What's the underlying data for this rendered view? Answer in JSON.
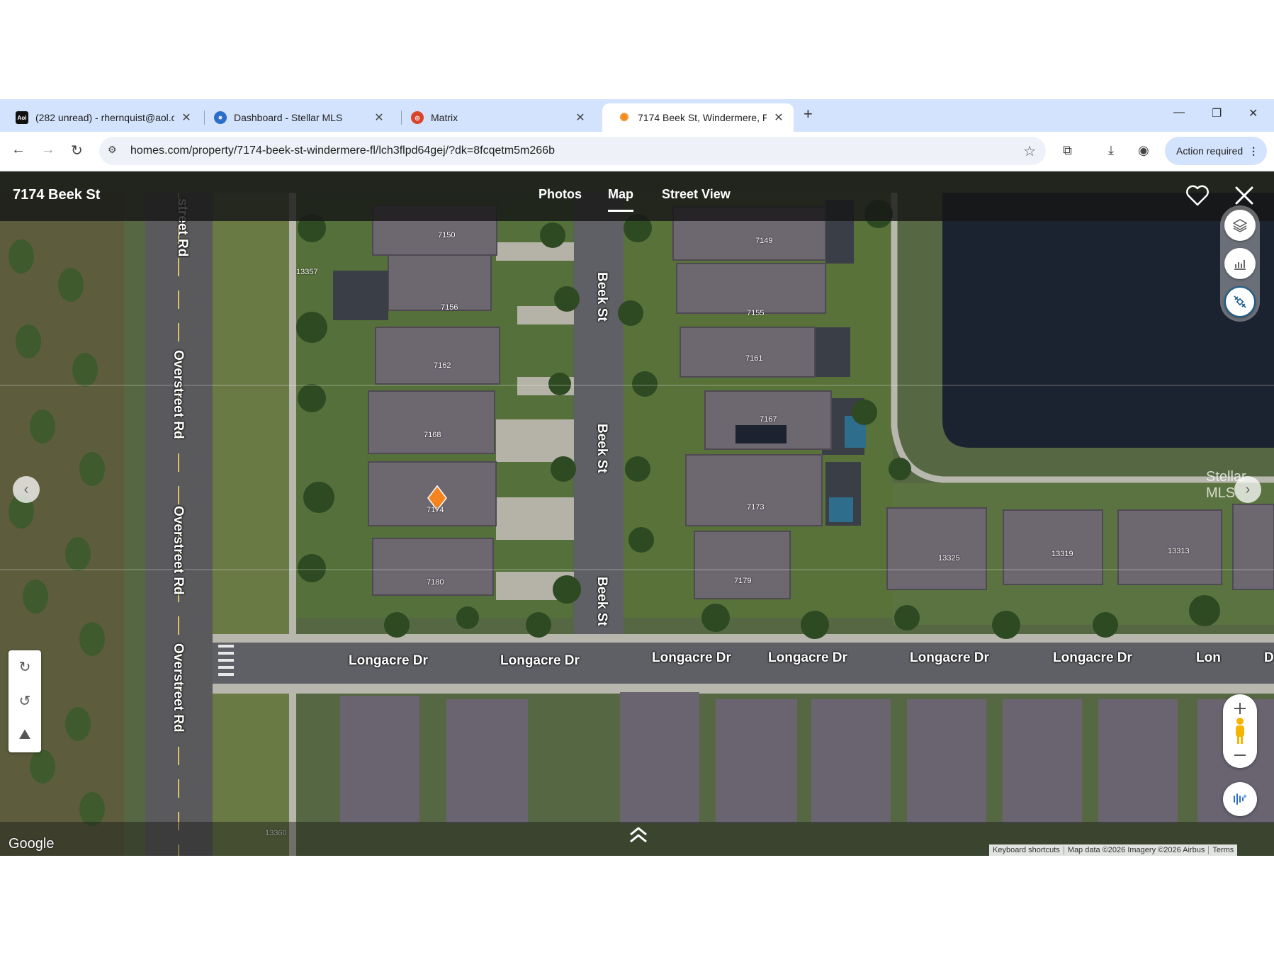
{
  "browser": {
    "tabs": [
      {
        "title": "(282 unread) - rhernquist@aol.c",
        "favicon": "aol-icon"
      },
      {
        "title": "Dashboard - Stellar MLS",
        "favicon": "stellar-icon"
      },
      {
        "title": "Matrix",
        "favicon": "matrix-icon"
      },
      {
        "title": "7174 Beek St, Windermere, FL 3",
        "favicon": "homes-icon"
      }
    ],
    "url": "homes.com/property/7174-beek-st-windermere-fl/lch3flpd64gej/?dk=8fcqetm5m266b",
    "action_required": "Action required"
  },
  "viewer": {
    "title": "7174 Beek St",
    "tabs": [
      "Photos",
      "Map",
      "Street View"
    ],
    "active_tab": "Map"
  },
  "map": {
    "streets": {
      "overstreet_top": "street Rd",
      "overstreet": "Overstreet Rd",
      "beek": "Beek St",
      "longacre": "Longacre Dr",
      "longacre_cut": "Lon",
      "longacre_d": "D"
    },
    "house_numbers": [
      "7150",
      "7156",
      "7162",
      "7168",
      "7174",
      "7180",
      "7149",
      "7155",
      "7161",
      "7167",
      "7173",
      "7179",
      "13325",
      "13319",
      "13313",
      "13357",
      "13360"
    ],
    "watermark": "Stellar MLS",
    "google": "Google",
    "attribution": [
      "Keyboard shortcuts",
      "Map data ©2026 Imagery ©2026 Airbus",
      "Terms"
    ],
    "colors": {
      "marker": "#f5841f",
      "header": "#161616",
      "tab_strip": "#d3e3fd"
    }
  }
}
